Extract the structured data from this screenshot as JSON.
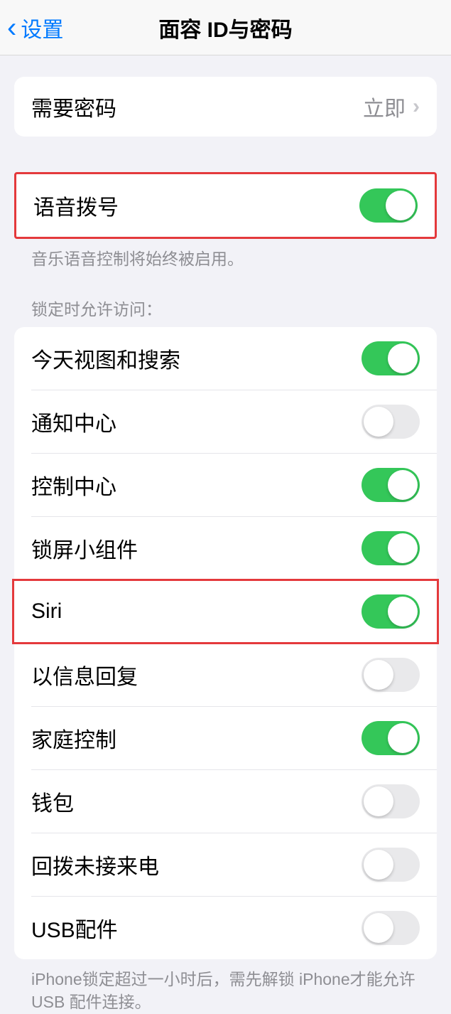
{
  "header": {
    "back_label": "设置",
    "title": "面容 ID与密码"
  },
  "require_passcode": {
    "label": "需要密码",
    "value": "立即"
  },
  "voice_dial": {
    "label": "语音拨号",
    "on": true,
    "note": "音乐语音控制将始终被启用。"
  },
  "locked_access": {
    "header": "锁定时允许访问：",
    "items": [
      {
        "label": "今天视图和搜索",
        "on": true
      },
      {
        "label": "通知中心",
        "on": false
      },
      {
        "label": "控制中心",
        "on": true
      },
      {
        "label": "锁屏小组件",
        "on": true
      },
      {
        "label": "Siri",
        "on": true,
        "highlighted": true
      },
      {
        "label": "以信息回复",
        "on": false
      },
      {
        "label": "家庭控制",
        "on": true
      },
      {
        "label": "钱包",
        "on": false
      },
      {
        "label": "回拨未接来电",
        "on": false
      },
      {
        "label": "USB配件",
        "on": false
      }
    ],
    "note": "iPhone锁定超过一小时后，需先解锁 iPhone才能允许USB 配件连接。"
  }
}
